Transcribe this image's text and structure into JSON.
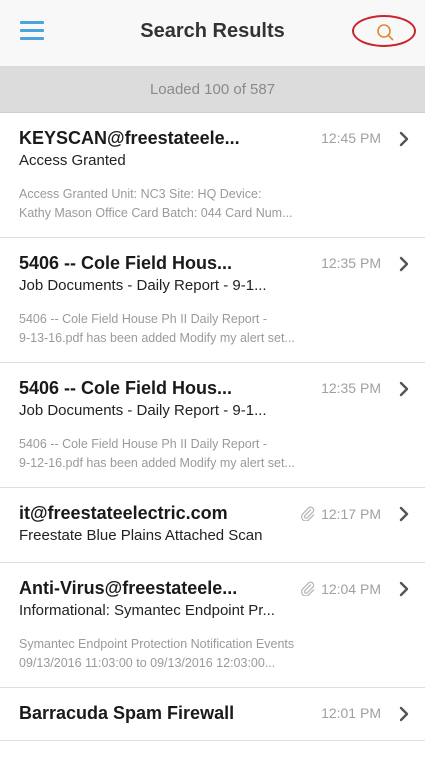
{
  "navbar": {
    "title": "Search Results",
    "menu_icon": "hamburger-menu-icon",
    "search_icon": "search-icon",
    "accent_color": "#4aa3df",
    "highlight_color": "#c8252e"
  },
  "banner": {
    "text": "Loaded 100 of 587"
  },
  "results": [
    {
      "sender": "KEYSCAN@freestateele...",
      "time": "12:45 PM",
      "subject": "Access Granted",
      "attachment": false,
      "preview": [
        "Access Granted  Unit: NC3  Site: HQ  Device:",
        "Kathy Mason Office  Card Batch: 044  Card Num..."
      ]
    },
    {
      "sender": "5406 -- Cole Field Hous...",
      "time": "12:35 PM",
      "subject": "Job Documents - Daily Report - 9-1...",
      "attachment": false,
      "preview": [
        "5406 -- Cole Field House Ph II Daily Report -",
        "9-13-16.pdf has been added Modify my alert set..."
      ]
    },
    {
      "sender": "5406 -- Cole Field Hous...",
      "time": "12:35 PM",
      "subject": "Job Documents - Daily Report - 9-1...",
      "attachment": false,
      "preview": [
        "5406 -- Cole Field House Ph II Daily Report -",
        "9-12-16.pdf has been added Modify my alert set..."
      ]
    },
    {
      "sender": "it@freestateelectric.com",
      "time": "12:17 PM",
      "subject": "Freestate Blue Plains Attached Scan",
      "attachment": true,
      "preview": []
    },
    {
      "sender": "Anti-Virus@freestateele...",
      "time": "12:04 PM",
      "subject": "Informational: Symantec Endpoint Pr...",
      "attachment": true,
      "preview": [
        "Symantec Endpoint Protection Notification Events",
        "09/13/2016 11:03:00 to 09/13/2016 12:03:00..."
      ]
    },
    {
      "sender": "Barracuda Spam Firewall",
      "time": "12:01 PM",
      "subject": "",
      "attachment": false,
      "preview": []
    }
  ]
}
